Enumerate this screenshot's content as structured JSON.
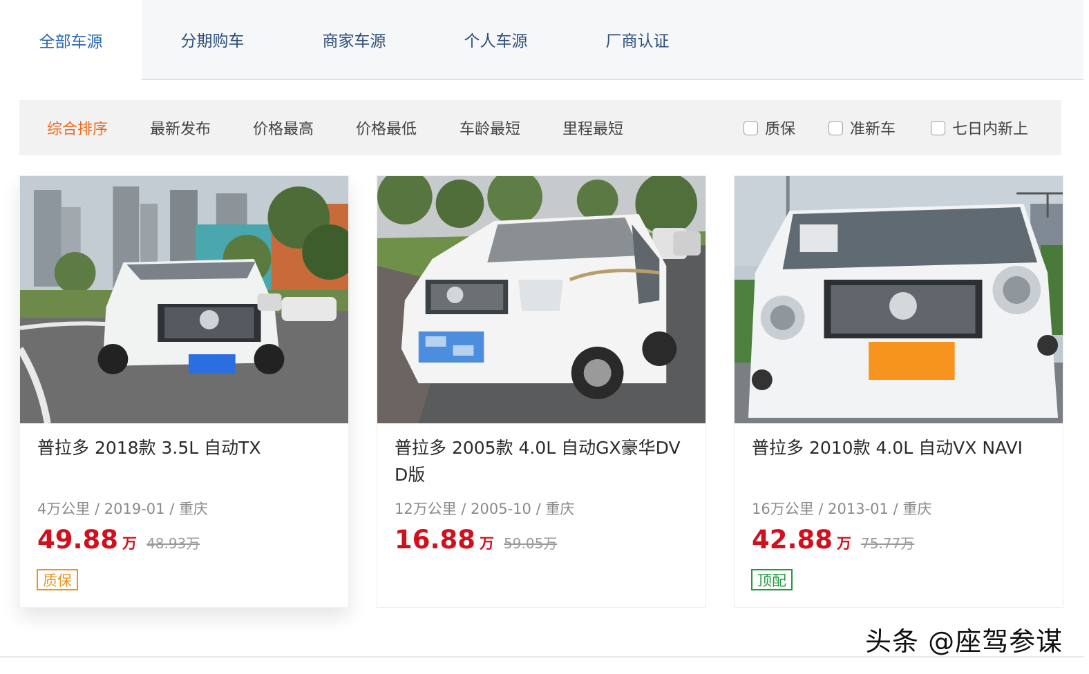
{
  "tabs": [
    {
      "label": "全部车源"
    },
    {
      "label": "分期购车"
    },
    {
      "label": "商家车源"
    },
    {
      "label": "个人车源"
    },
    {
      "label": "厂商认证"
    }
  ],
  "sort": [
    {
      "label": "综合排序"
    },
    {
      "label": "最新发布"
    },
    {
      "label": "价格最高"
    },
    {
      "label": "价格最低"
    },
    {
      "label": "车龄最短"
    },
    {
      "label": "里程最短"
    }
  ],
  "filters": [
    {
      "label": "质保",
      "checked": false
    },
    {
      "label": "准新车",
      "checked": false
    },
    {
      "label": "七日内新上",
      "checked": false
    }
  ],
  "listings": [
    {
      "title": "普拉多 2018款 3.5L 自动TX",
      "meta": "4万公里 / 2019-01 / 重庆",
      "price": "49.88",
      "unit": "万",
      "original_price": "48.93万",
      "badge": "质保",
      "badge_color": "#e8961e"
    },
    {
      "title": "普拉多 2005款 4.0L 自动GX豪华DVD版",
      "meta": "12万公里 / 2005-10 / 重庆",
      "price": "16.88",
      "unit": "万",
      "original_price": "59.05万",
      "badge": "",
      "badge_color": ""
    },
    {
      "title": "普拉多 2010款 4.0L 自动VX NAVI",
      "meta": "16万公里 / 2013-01 / 重庆",
      "price": "42.88",
      "unit": "万",
      "original_price": "75.77万",
      "badge": "顶配",
      "badge_color": "#1f9a3e"
    }
  ],
  "watermark": "头条 @座驾参谋",
  "colors": {
    "active_tab": "#2b66b0",
    "active_sort": "#ef6b1f",
    "price": "#d0101c"
  }
}
